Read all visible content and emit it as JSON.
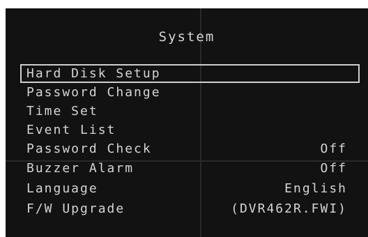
{
  "title": "System",
  "menu": {
    "items": [
      {
        "label": "Hard Disk Setup",
        "value": "",
        "selected": true
      },
      {
        "label": "Password Change",
        "value": ""
      },
      {
        "label": "Time Set",
        "value": ""
      },
      {
        "label": "Event List",
        "value": ""
      },
      {
        "label": "Password Check",
        "value": "Off"
      },
      {
        "label": "Buzzer Alarm",
        "value": "Off"
      },
      {
        "label": "Language",
        "value": "English"
      },
      {
        "label": "F/W Upgrade",
        "value": "(DVR462R.FWI)"
      }
    ]
  },
  "colors": {
    "background": "#121212",
    "text": "#d4d4d4",
    "selection_border": "#cfcfcf"
  }
}
